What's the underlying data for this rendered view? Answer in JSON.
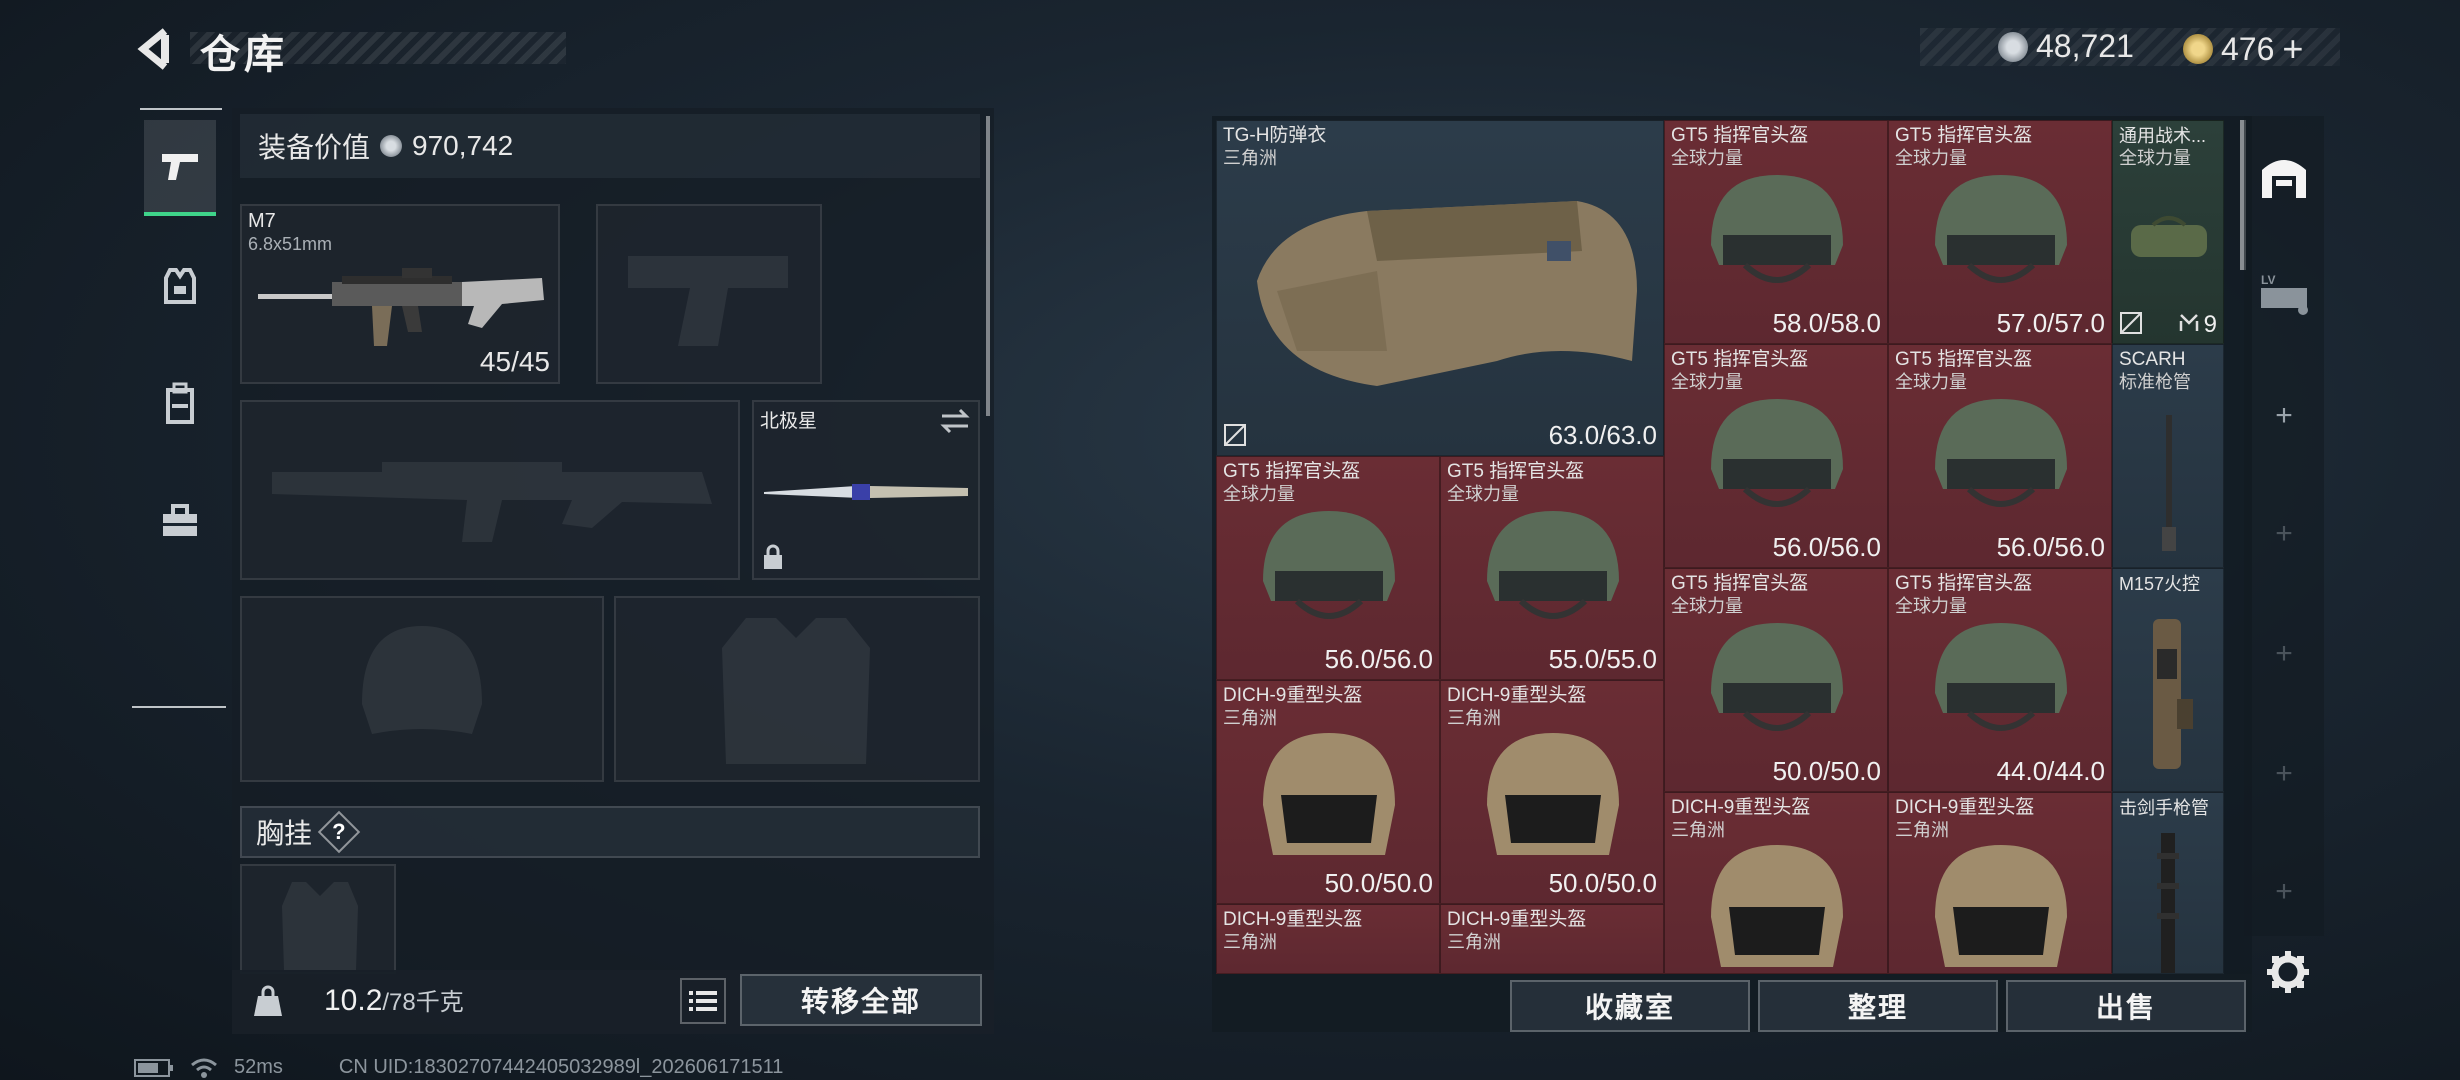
{
  "header": {
    "title": "仓库",
    "currency_a": "48,721",
    "currency_b": "476",
    "currency_b_plus": "+"
  },
  "left_nav": {
    "items": [
      {
        "name": "weapons",
        "active": true
      },
      {
        "name": "armor"
      },
      {
        "name": "backpack"
      },
      {
        "name": "toolbox"
      }
    ]
  },
  "equipment": {
    "value_label": "装备价值",
    "value": "970,742",
    "primary": {
      "name": "M7",
      "caliber": "6.8x51mm",
      "ammo": "45/45"
    },
    "melee": {
      "name": "北极星"
    },
    "chest_rig_label": "胸挂",
    "chest_help": "?",
    "weight": "10.2",
    "weight_max": "/78千克",
    "transfer_all": "转移全部"
  },
  "inventory": {
    "items": [
      {
        "id": "vest",
        "name": "TG-H防弹衣",
        "sub": "三角洲",
        "dur": "63.0/63.0"
      },
      {
        "id": "h1",
        "name": "GT5 指挥官头盔",
        "sub": "全球力量",
        "dur": "58.0/58.0"
      },
      {
        "id": "h2",
        "name": "GT5 指挥官头盔",
        "sub": "全球力量",
        "dur": "57.0/57.0"
      },
      {
        "id": "bag",
        "name": "通用战术...",
        "sub": "全球力量",
        "count": "9"
      },
      {
        "id": "h3",
        "name": "GT5 指挥官头盔",
        "sub": "全球力量",
        "dur": "56.0/56.0"
      },
      {
        "id": "h4",
        "name": "GT5 指挥官头盔",
        "sub": "全球力量",
        "dur": "56.0/56.0"
      },
      {
        "id": "scar",
        "name": "SCARH",
        "sub": "标准枪管"
      },
      {
        "id": "h5",
        "name": "GT5 指挥官头盔",
        "sub": "全球力量",
        "dur": "56.0/56.0"
      },
      {
        "id": "h6",
        "name": "GT5 指挥官头盔",
        "sub": "全球力量",
        "dur": "55.0/55.0"
      },
      {
        "id": "h7",
        "name": "GT5 指挥官头盔",
        "sub": "全球力量",
        "dur": "50.0/50.0"
      },
      {
        "id": "h8",
        "name": "GT5 指挥官头盔",
        "sub": "全球力量",
        "dur": "44.0/44.0"
      },
      {
        "id": "m157",
        "name": "M157火控"
      },
      {
        "id": "d1",
        "name": "DICH-9重型头盔",
        "sub": "三角洲",
        "dur": "50.0/50.0"
      },
      {
        "id": "d2",
        "name": "DICH-9重型头盔",
        "sub": "三角洲",
        "dur": "50.0/50.0"
      },
      {
        "id": "d3",
        "name": "DICH-9重型头盔",
        "sub": "三角洲"
      },
      {
        "id": "d4",
        "name": "DICH-9重型头盔",
        "sub": "三角洲"
      },
      {
        "id": "barrel",
        "name": "击剑手枪管"
      },
      {
        "id": "d5",
        "name": "DICH-9重型头盔",
        "sub": "三角洲"
      },
      {
        "id": "d6",
        "name": "DICH-9重型头盔",
        "sub": "三角洲"
      }
    ],
    "btn_vault": "收藏室",
    "btn_sort": "整理",
    "btn_sell": "出售"
  },
  "right_nav": {
    "plus": "+"
  },
  "status": {
    "ping": "52ms",
    "uid": "CN UID:18302707442405032989l_202606171511"
  }
}
